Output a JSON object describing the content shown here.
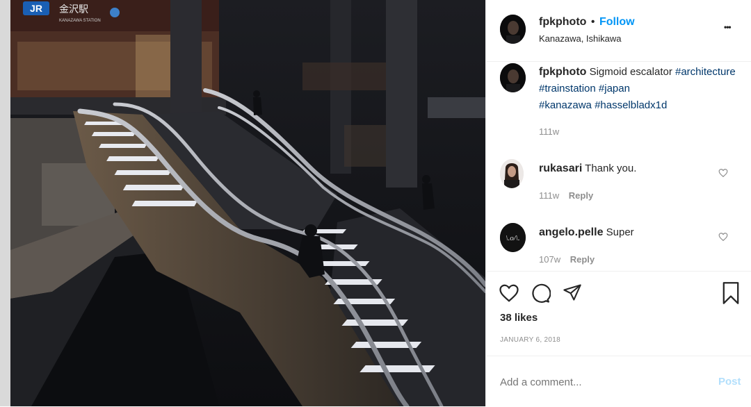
{
  "post": {
    "username": "fpkphoto",
    "separator": "•",
    "follow_label": "Follow",
    "location": "Kanazawa, Ishikawa",
    "more_label": "•••",
    "caption_text": "Sigmoid escalator",
    "hashtags": [
      "#architecture",
      "#trainstation",
      "#japan",
      "#kanazawa",
      "#hasselbladx1d"
    ],
    "caption_age": "111w",
    "likes": "38 likes",
    "date": "JANUARY 6, 2018"
  },
  "photo_sign": {
    "logo": "JR",
    "station": "金沢駅",
    "station_romaji": "KANAZAWA STATION"
  },
  "comments": [
    {
      "username": "rukasari",
      "text": "Thank you.",
      "age": "111w",
      "reply_label": "Reply"
    },
    {
      "username": "angelo.pelle",
      "text": "Super",
      "age": "107w",
      "reply_label": "Reply",
      "avatar_text": "\\.o/\\."
    }
  ],
  "add_comment": {
    "placeholder": "Add a comment...",
    "post_label": "Post"
  },
  "colors": {
    "accent": "#0095f6",
    "hashtag": "#00376b",
    "muted": "#8e8e8e",
    "post_disabled": "#b2dffc"
  }
}
